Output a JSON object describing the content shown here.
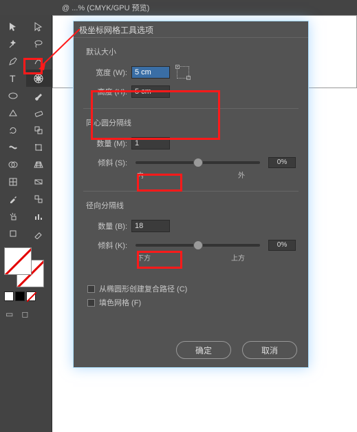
{
  "app": {
    "doc_title": "@ ...%  (CMYK/GPU 预览)"
  },
  "dialog": {
    "title": "极坐标网格工具选项",
    "default_size": {
      "title": "默认大小",
      "width_label": "宽度 (W):",
      "width_value": "5 cm",
      "height_label": "高度 (H):",
      "height_value": "5 cm"
    },
    "concentric": {
      "title": "同心圆分隔线",
      "count_label": "数量 (M):",
      "count_value": "1",
      "skew_label": "倾斜 (S):",
      "skew_pct": "0%",
      "skew_left": "内",
      "skew_right": "外"
    },
    "radial": {
      "title": "径向分隔线",
      "count_label": "数量 (B):",
      "count_value": "18",
      "skew_label": "倾斜 (K):",
      "skew_pct": "0%",
      "skew_left": "下方",
      "skew_right": "上方"
    },
    "opts": {
      "compound": "从椭圆形创建复合路径 (C)",
      "fill": "填色网格 (F)"
    },
    "buttons": {
      "ok": "确定",
      "cancel": "取消"
    }
  },
  "tools": {
    "polar_grid": "polar-grid-tool"
  }
}
